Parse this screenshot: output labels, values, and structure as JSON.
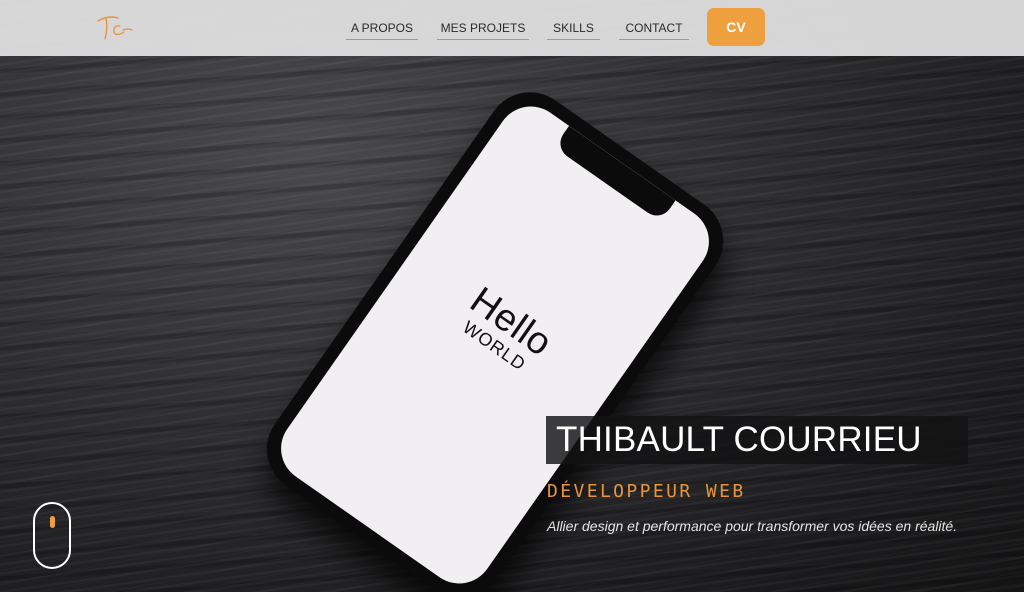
{
  "header": {
    "logo_text": "Tc",
    "nav": [
      {
        "label": "A PROPOS"
      },
      {
        "label": "MES PROJETS"
      },
      {
        "label": "SKILLS"
      },
      {
        "label": "CONTACT"
      }
    ],
    "cv_button": "CV"
  },
  "hero": {
    "phone_text": {
      "hello": "Hello",
      "world": "WORLD"
    },
    "name": "THIBAULT COURRIEU",
    "job_title": "DÉVELOPPEUR WEB",
    "tagline": "Allier design et performance pour transformer vos idées en réalité.",
    "scroll_indicator_icon": "mouse-scroll-icon"
  },
  "colors": {
    "accent": "#ee9f3e",
    "navbar_bg": "#dedede",
    "text_light": "#ffffff"
  }
}
